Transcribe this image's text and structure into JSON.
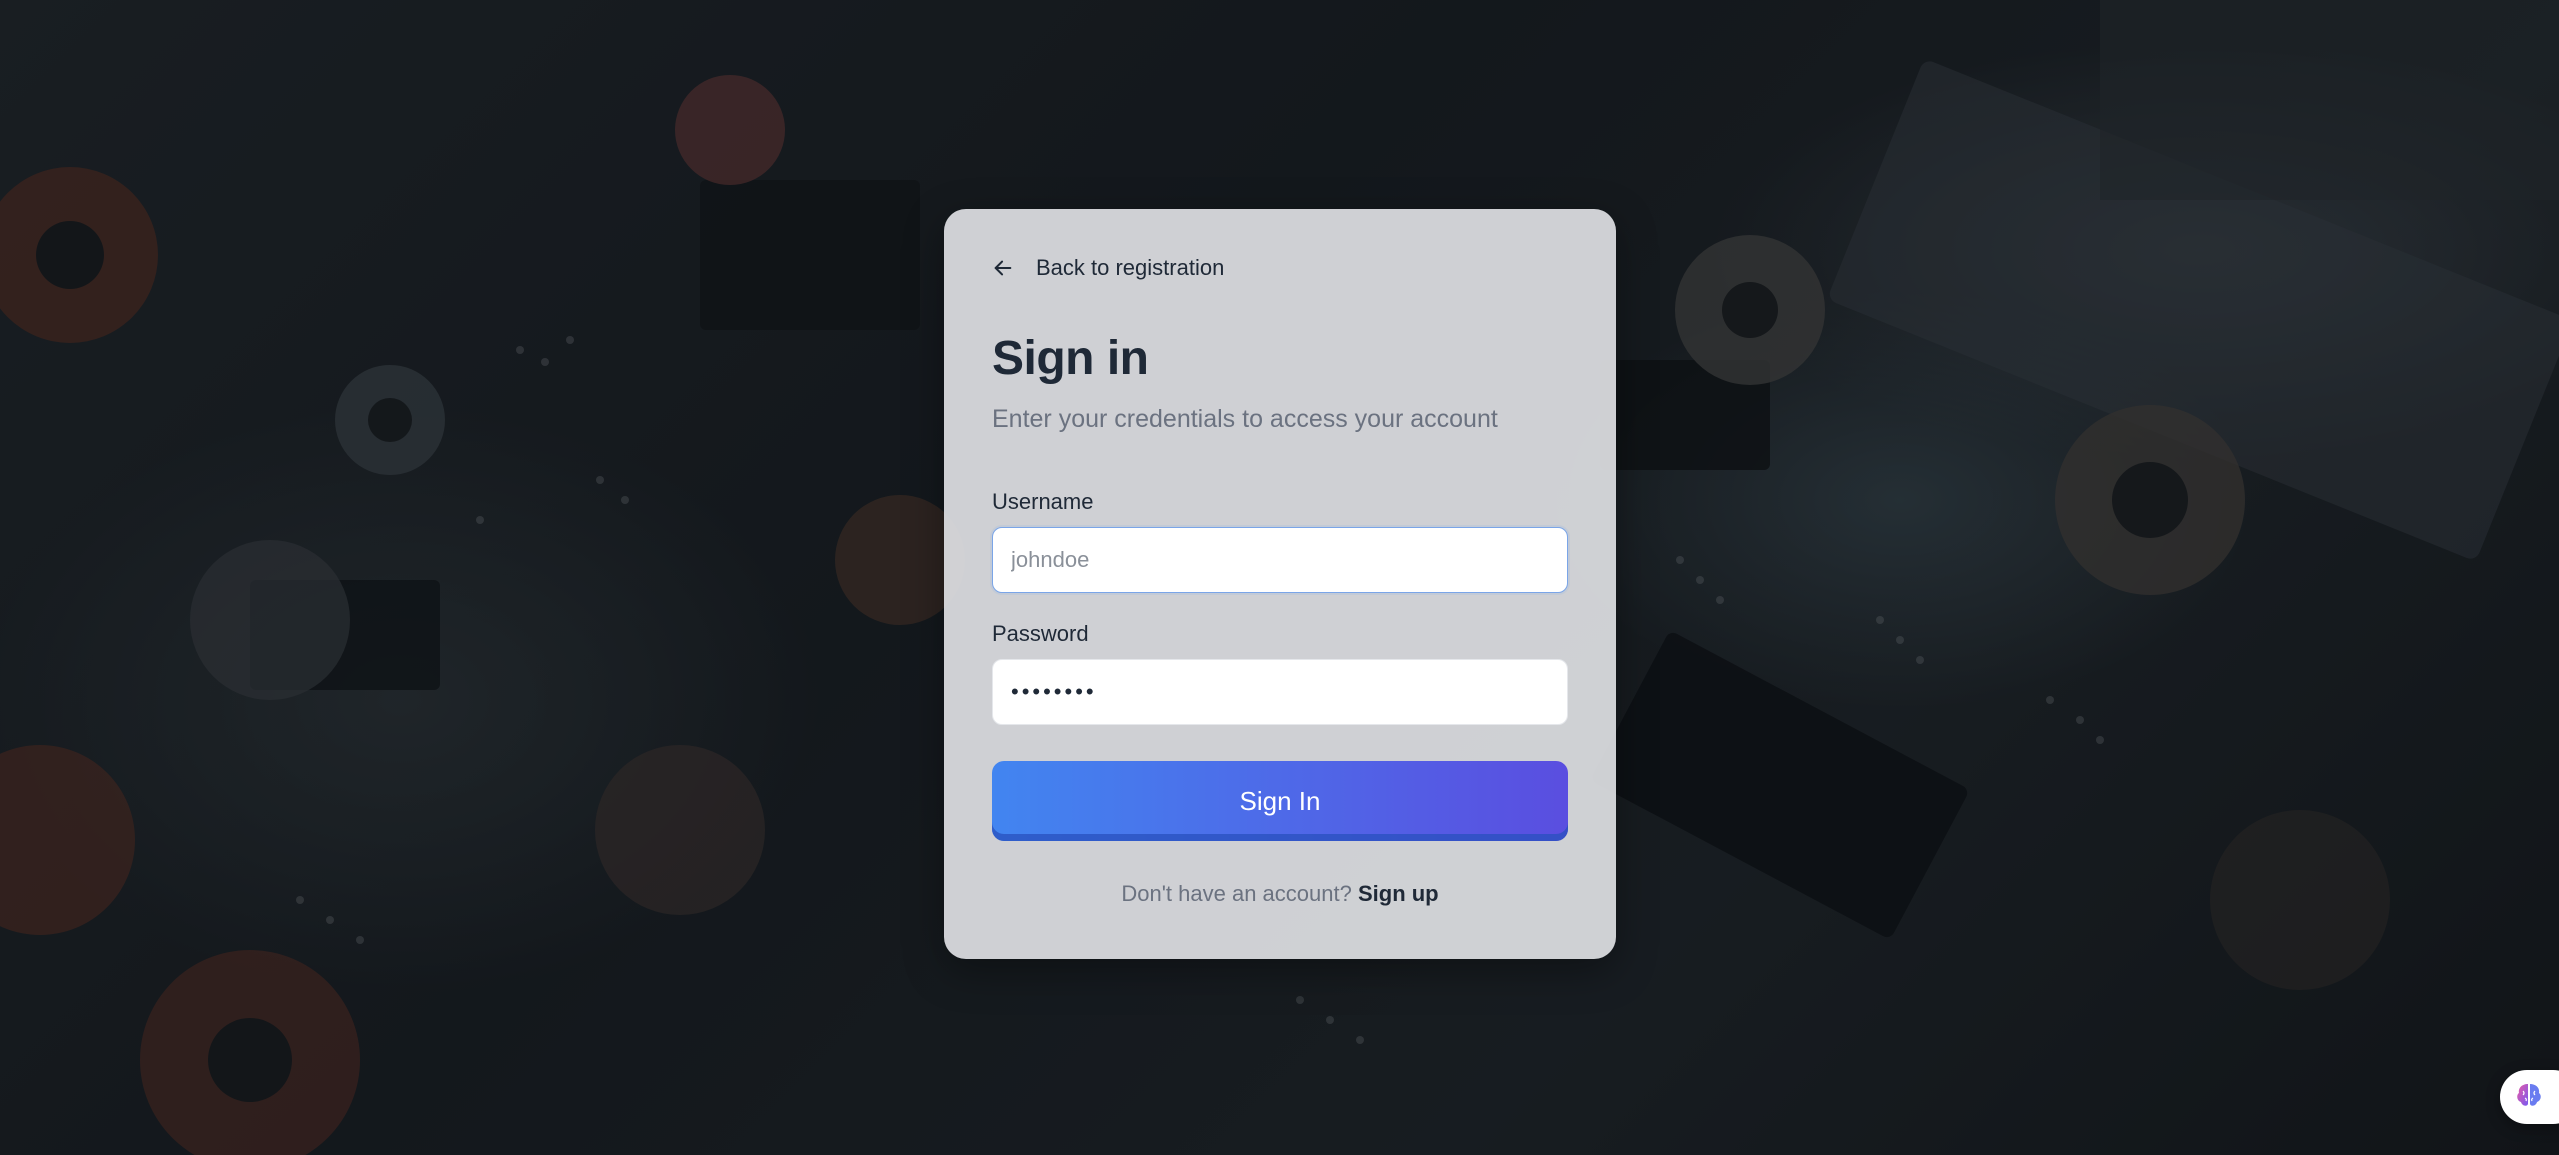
{
  "background": {
    "description_icon": "circuit-board-background"
  },
  "card": {
    "back_link": {
      "icon": "arrow-left-icon",
      "label": "Back to registration"
    },
    "title": "Sign in",
    "subtitle": "Enter your credentials to access your account",
    "username": {
      "label": "Username",
      "placeholder": "johndoe",
      "value": ""
    },
    "password": {
      "label": "Password",
      "value": "••••••••"
    },
    "submit_label": "Sign In",
    "signup": {
      "prompt": "Don't have an account?",
      "link": "Sign up"
    }
  },
  "widget": {
    "icon": "brain-icon"
  },
  "colors": {
    "primary_gradient_start": "#4285f0",
    "primary_gradient_end": "#5a4ee0",
    "text_dark": "#1f2937",
    "text_muted": "#6b7280",
    "focus_border": "#7aa5e8"
  }
}
